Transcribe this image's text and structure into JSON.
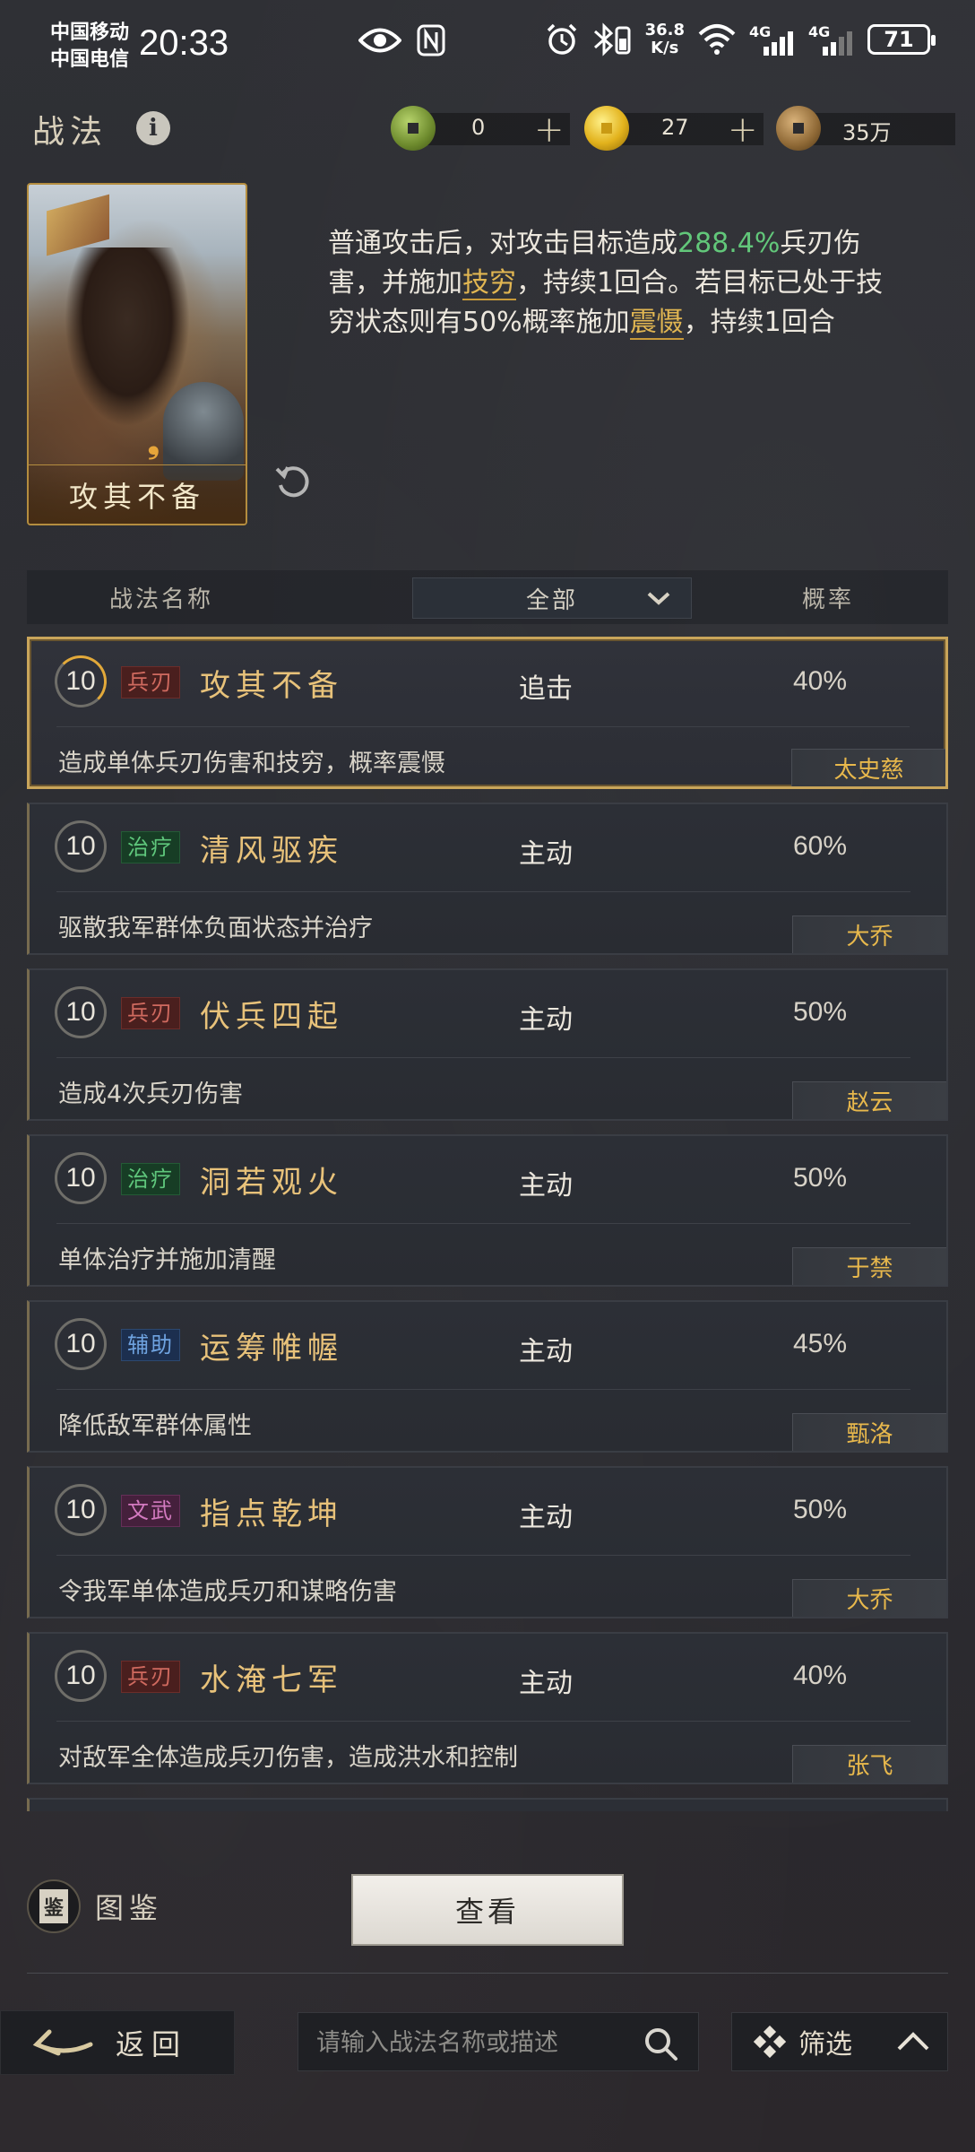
{
  "status_bar": {
    "carrier1": "中国移动",
    "carrier2": "中国电信",
    "time": "20:33",
    "net_speed_value": "36.8",
    "net_speed_unit": "K/s",
    "signal1_label": "4G",
    "signal2_label": "4G",
    "battery": "71"
  },
  "header": {
    "title": "战法",
    "info_icon": "i",
    "currencies": [
      {
        "icon": "jade-coin-icon",
        "value": "0",
        "plus": "+"
      },
      {
        "icon": "gold-coin-icon",
        "value": "27",
        "plus": "+"
      },
      {
        "icon": "copper-coin-icon",
        "value": "35万"
      }
    ]
  },
  "featured": {
    "card_name": "攻其不备",
    "desc": {
      "p1": "普通攻击后，对攻击目标造成",
      "pct": "288.4%",
      "p2": "兵刃伤害，并施加",
      "link1": "技穷",
      "p3": "，持续1回合。若目标已处于技穷状态则有50%概率施加",
      "link2": "震慑",
      "p4": "，持续1回合"
    }
  },
  "filter": {
    "col_name": "战法名称",
    "select_value": "全部",
    "col_rate": "概率"
  },
  "skills": [
    {
      "level": "10",
      "tag": "兵刃",
      "tag_type": "bingren",
      "name": "攻其不备",
      "type": "追击",
      "rate": "40%",
      "desc": "造成单体兵刃伤害和技穷，概率震慑",
      "owner": "太史慈",
      "selected": true
    },
    {
      "level": "10",
      "tag": "治疗",
      "tag_type": "zhiliao",
      "name": "清风驱疾",
      "type": "主动",
      "rate": "60%",
      "desc": "驱散我军群体负面状态并治疗",
      "owner": "大乔"
    },
    {
      "level": "10",
      "tag": "兵刃",
      "tag_type": "bingren",
      "name": "伏兵四起",
      "type": "主动",
      "rate": "50%",
      "desc": "造成4次兵刃伤害",
      "owner": "赵云"
    },
    {
      "level": "10",
      "tag": "治疗",
      "tag_type": "zhiliao",
      "name": "洞若观火",
      "type": "主动",
      "rate": "50%",
      "desc": "单体治疗并施加清醒",
      "owner": "于禁"
    },
    {
      "level": "10",
      "tag": "辅助",
      "tag_type": "fuzhu",
      "name": "运筹帷幄",
      "type": "主动",
      "rate": "45%",
      "desc": "降低敌军群体属性",
      "owner": "甄洛"
    },
    {
      "level": "10",
      "tag": "文武",
      "tag_type": "wenwu",
      "name": "指点乾坤",
      "type": "主动",
      "rate": "50%",
      "desc": "令我军单体造成兵刃和谋略伤害",
      "owner": "大乔"
    },
    {
      "level": "10",
      "tag": "兵刃",
      "tag_type": "bingren",
      "name": "水淹七军",
      "type": "主动",
      "rate": "40%",
      "desc": "对敌军全体造成兵刃伤害，造成洪水和控制",
      "owner": "张飞"
    }
  ],
  "bottom": {
    "atlas_icon_char": "鉴",
    "atlas_label": "图鉴",
    "view_button": "查看",
    "back_label": "返回",
    "search_placeholder": "请输入战法名称或描述",
    "filter_label": "筛选"
  }
}
